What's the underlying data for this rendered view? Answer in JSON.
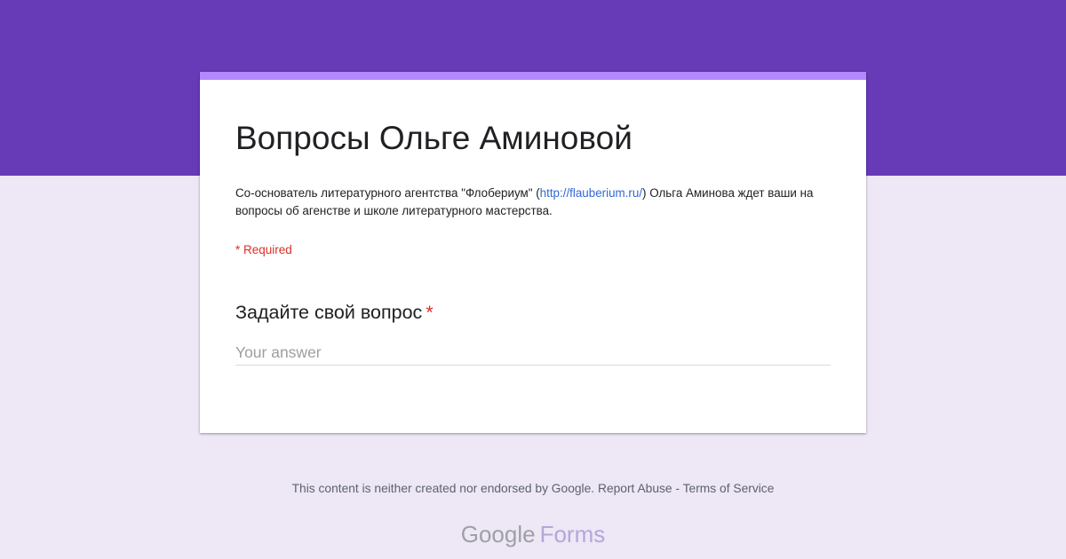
{
  "colors": {
    "header_band": "#673ab7",
    "page_background": "#ede7f6",
    "card_accent": "#b388ff",
    "link": "#3367d6",
    "required": "#d93025"
  },
  "form": {
    "title": "Вопросы Ольге Аминовой",
    "description_before_link": "Со-основатель литературного агентства \"Флобериум\" (",
    "description_link": "http://flauberium.ru/",
    "description_after_link": ") Ольга Аминова ждет ваши на вопросы об агенстве и школе литературного мастерства.",
    "required_note": "* Required"
  },
  "question": {
    "title": "Задайте свой вопрос",
    "required_mark": "*",
    "answer_placeholder": "Your answer",
    "answer_value": ""
  },
  "footer": {
    "disclaimer": "This content is neither created nor endorsed by Google.",
    "report_abuse": "Report Abuse",
    "separator": "-",
    "terms": "Terms of Service"
  },
  "branding": {
    "google": "Google",
    "forms": "Forms"
  }
}
